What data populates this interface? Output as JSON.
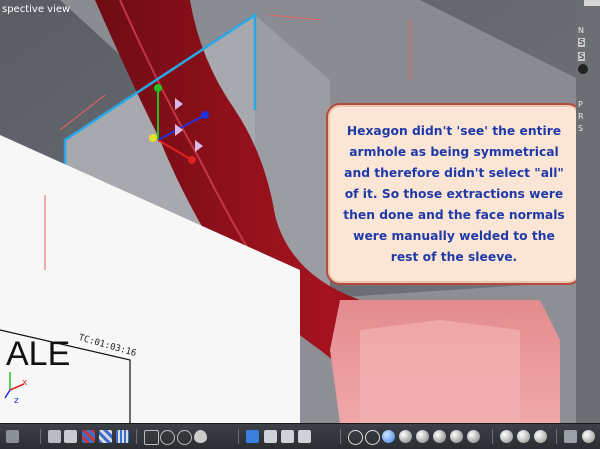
{
  "viewport": {
    "label": "spective view"
  },
  "drawing": {
    "text_large": "ALE",
    "timecode": "TC:01:03:16"
  },
  "axis_gizmo": {
    "x_label": "x",
    "z_label": "z"
  },
  "callout": {
    "text": "Hexagon didn't 'see' the entire armhole as being symmetrical and therefore didn't select \"all\" of it. So those extractions were then done and the face normals were manually welded to the rest of the sleeve."
  },
  "right_panel": {
    "items": [
      "N",
      "S",
      "S",
      "P",
      "R",
      "S"
    ]
  },
  "colors": {
    "sleeve_red": "#a3121e",
    "selection_blue": "#29a8e8",
    "callout_bg": "#fbe6d6",
    "callout_border": "#b54a3e",
    "callout_text": "#1f3aa8"
  },
  "toolbar": {
    "groups": [
      {
        "name": "layout",
        "icons": [
          "grid-icon",
          "settings-icon",
          "checker-icon",
          "checker-icon",
          "checker-icon"
        ]
      },
      {
        "name": "navigation",
        "icons": [
          "frame-icon",
          "target-icon",
          "zoom-icon",
          "eye-icon"
        ]
      },
      {
        "name": "manipulators",
        "icons": [
          "select-icon",
          "move-icon",
          "rotate-icon",
          "scale-icon"
        ]
      },
      {
        "name": "shading",
        "icons": [
          "wire-sphere-icon",
          "wire-sphere-icon",
          "smooth-sphere-icon",
          "smooth-sphere-icon",
          "smooth-sphere-icon",
          "smooth-sphere-icon",
          "smooth-sphere-icon",
          "smooth-sphere-icon"
        ]
      },
      {
        "name": "render",
        "icons": [
          "lamp-icon",
          "lamp-icon",
          "lamp-icon"
        ]
      },
      {
        "name": "misc",
        "icons": [
          "shield-icon",
          "sphere-icon"
        ]
      }
    ]
  }
}
